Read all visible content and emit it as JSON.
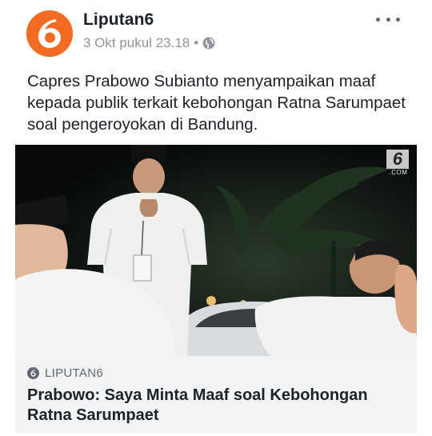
{
  "post": {
    "page_name": "Liputan6",
    "timestamp": "3 Okt pukul 23.18",
    "separator": "•",
    "privacy_icon": "globe-icon",
    "menu_icon": "more-options-icon",
    "avatar_logo": "liputan6-logo-icon",
    "caption": "Capres Prabowo Subianto menyampaikan maaf kepada publik terkait kebohongan Ratna Sarumpaet soal pengeroyokan di Bandung."
  },
  "photo": {
    "watermark_number": "6",
    "watermark_domain": ".COM"
  },
  "link": {
    "source": "LIPUTAN6",
    "source_icon": "link-source-icon",
    "headline": "Prabowo: Saya Minta Maaf soal Kebohongan Ratna Sarumpaet"
  },
  "colors": {
    "brand_orange": "#f26b21",
    "text_primary": "#1d2129",
    "text_secondary": "#90949c",
    "link_bg": "#f2f3f5"
  }
}
